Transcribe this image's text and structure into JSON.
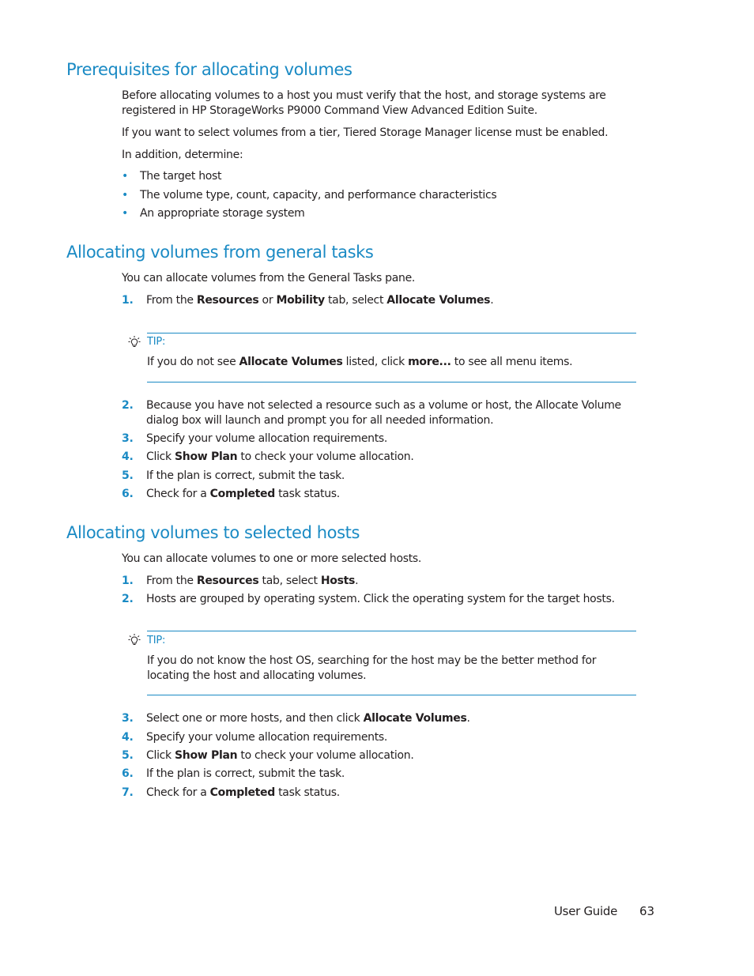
{
  "sections": [
    {
      "title": "Prerequisites for allocating volumes",
      "paragraphs": [
        "Before allocating volumes to a host you must verify that the host, and storage systems are registered in HP StorageWorks P9000 Command View Advanced Edition Suite.",
        "If you want to select volumes from a tier, Tiered Storage Manager license must be enabled.",
        "In addition, determine:"
      ],
      "bullets": [
        "The target host",
        "The volume type, count, capacity, and performance characteristics",
        "An appropriate storage system"
      ]
    },
    {
      "title": "Allocating volumes from general tasks",
      "intro": "You can allocate volumes from the General Tasks pane.",
      "steps": [
        {
          "num": "1.",
          "parts": [
            "From the ",
            "Resources",
            " or ",
            "Mobility",
            " tab, select ",
            "Allocate Volumes",
            "."
          ]
        },
        {
          "num": "2.",
          "text": "Because you have not selected a resource such as a volume or host, the Allocate Volume dialog box will launch and prompt you for all needed information."
        },
        {
          "num": "3.",
          "text": "Specify your volume allocation requirements."
        },
        {
          "num": "4.",
          "parts": [
            "Click ",
            "Show Plan",
            " to check your volume allocation."
          ]
        },
        {
          "num": "5.",
          "text": "If the plan is correct, submit the task."
        },
        {
          "num": "6.",
          "parts": [
            "Check for a ",
            "Completed",
            " task status."
          ]
        }
      ],
      "tip": {
        "label": "TIP:",
        "parts": [
          "If you do not see ",
          "Allocate Volumes",
          " listed, click ",
          "more...",
          " to see all menu items."
        ]
      }
    },
    {
      "title": "Allocating volumes to selected hosts",
      "intro": "You can allocate volumes to one or more selected hosts.",
      "steps": [
        {
          "num": "1.",
          "parts": [
            "From the ",
            "Resources",
            " tab, select ",
            "Hosts",
            "."
          ]
        },
        {
          "num": "2.",
          "text": "Hosts are grouped by operating system. Click the operating system for the target hosts."
        },
        {
          "num": "3.",
          "parts": [
            "Select one or more hosts, and then click ",
            "Allocate Volumes",
            "."
          ]
        },
        {
          "num": "4.",
          "text": "Specify your volume allocation requirements."
        },
        {
          "num": "5.",
          "parts": [
            "Click ",
            "Show Plan",
            " to check your volume allocation."
          ]
        },
        {
          "num": "6.",
          "text": "If the plan is correct, submit the task."
        },
        {
          "num": "7.",
          "parts": [
            "Check for a ",
            "Completed",
            " task status."
          ]
        }
      ],
      "tip": {
        "label": "TIP:",
        "text": "If you do not know the host OS, searching for the host may be the better method for locating the host and allocating volumes."
      }
    }
  ],
  "footer": {
    "label": "User Guide",
    "page_number": "63"
  },
  "colors": {
    "accent": "#1a8ac4",
    "text": "#231f20"
  }
}
